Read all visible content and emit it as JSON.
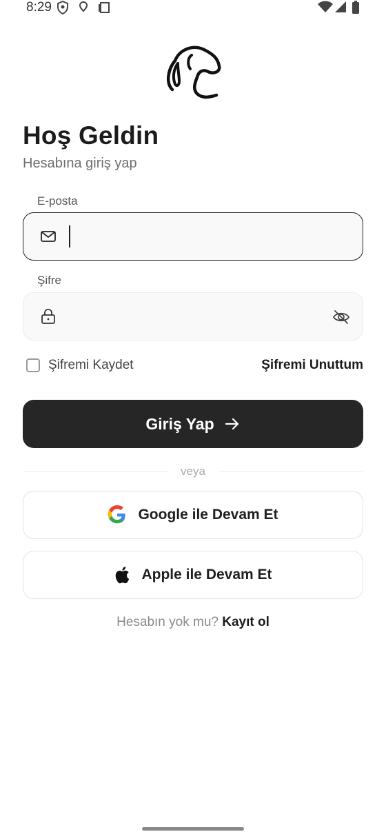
{
  "status_bar": {
    "time": "8:29",
    "left_icons": [
      "shield-icon",
      "location-icon",
      "clipboard-icon"
    ],
    "right_icons": [
      "wifi-icon",
      "signal-icon",
      "battery-icon"
    ]
  },
  "logo": "dog-logo-icon",
  "title": "Hoş Geldin",
  "subtitle": "Hesabına giriş yap",
  "email": {
    "label": "E-posta",
    "value": "",
    "icon": "mail-icon"
  },
  "password": {
    "label": "Şifre",
    "value": "",
    "icon": "lock-icon",
    "toggle_icon": "eye-off-icon"
  },
  "remember": {
    "label": "Şifremi Kaydet",
    "checked": false
  },
  "forgot_label": "Şifremi Unuttum",
  "login_label": "Giriş Yap",
  "divider_text": "veya",
  "google_label": "Google ile Devam Et",
  "apple_label": "Apple ile Devam Et",
  "signup": {
    "prompt": "Hesabın yok mu?",
    "link": "Kayıt ol"
  },
  "colors": {
    "primary": "#262626",
    "background": "#ffffff",
    "input_bg": "#f9f9f9"
  }
}
